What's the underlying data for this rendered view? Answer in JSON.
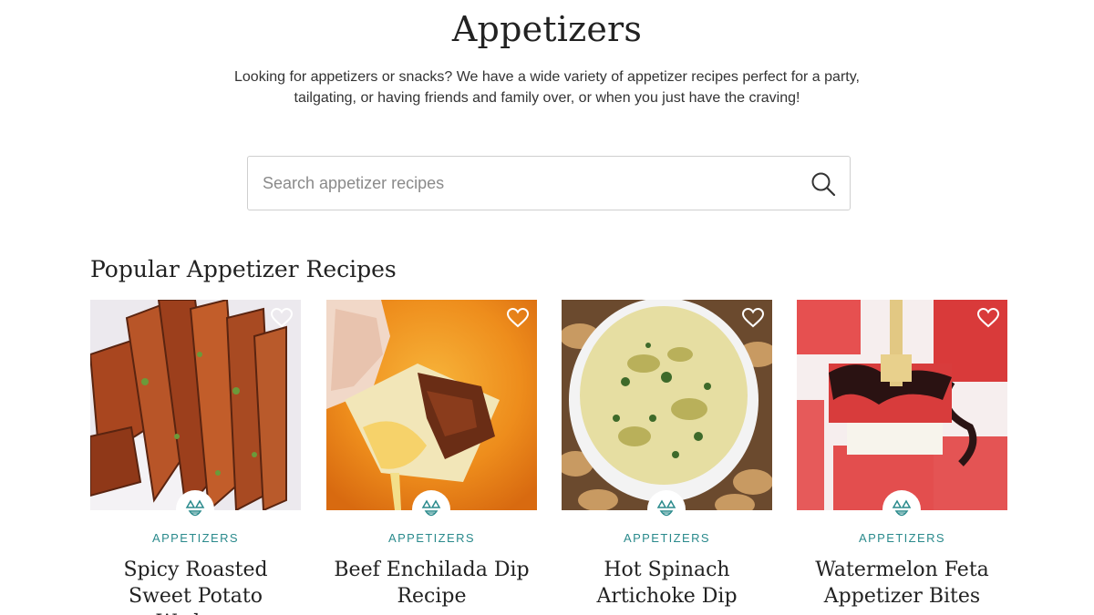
{
  "header": {
    "title": "Appetizers",
    "description": "Looking for appetizers or snacks? We have a wide variety of appetizer recipes perfect for a party, tailgating, or having friends and family over, or when you just have the craving!"
  },
  "search": {
    "placeholder": "Search appetizer recipes",
    "value": "",
    "icon": "search-icon"
  },
  "popular": {
    "heading": "Popular Appetizer Recipes",
    "cards": [
      {
        "category": "APPETIZERS",
        "title": "Spicy Roasted Sweet Potato Wedges",
        "image": "sweet-potato-wedges-photo"
      },
      {
        "category": "APPETIZERS",
        "title": "Beef Enchilada Dip Recipe",
        "image": "enchilada-dip-photo"
      },
      {
        "category": "APPETIZERS",
        "title": "Hot Spinach Artichoke Dip",
        "image": "spinach-artichoke-dip-photo"
      },
      {
        "category": "APPETIZERS",
        "title": "Watermelon Feta Appetizer Bites",
        "image": "watermelon-feta-bites-photo"
      }
    ]
  },
  "colors": {
    "accent": "#2a8a8c",
    "text": "#222222",
    "border": "#cfcfcf"
  }
}
